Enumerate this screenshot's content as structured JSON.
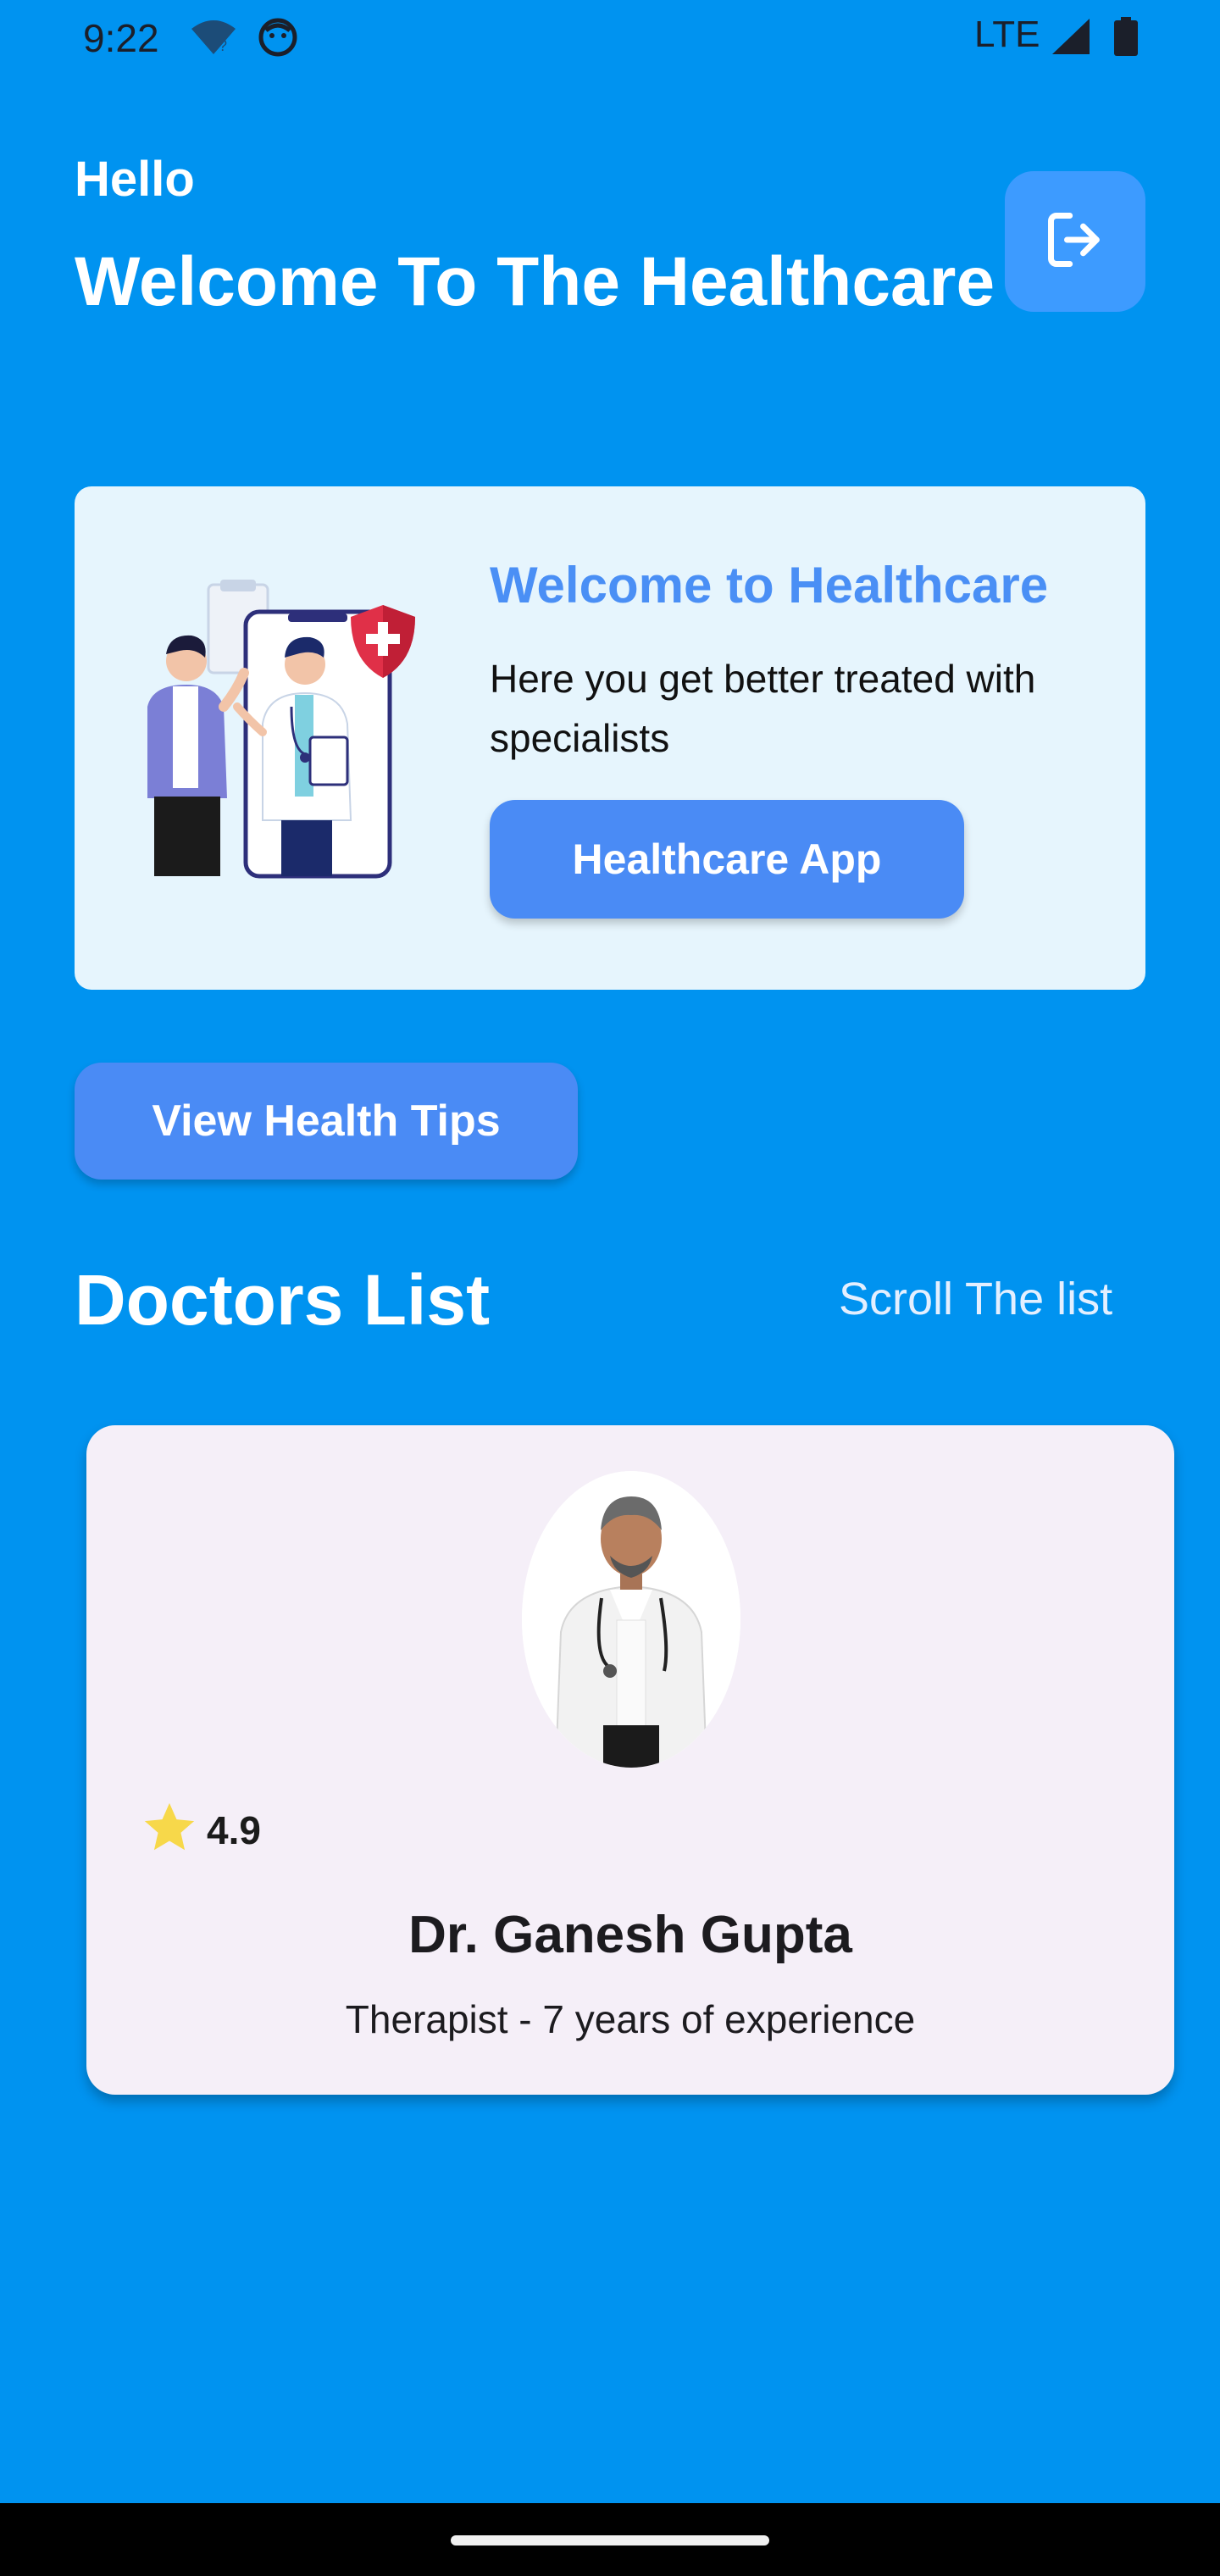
{
  "status_bar": {
    "time": "9:22",
    "network": "LTE",
    "icons": [
      "wifi-icon",
      "face-icon",
      "signal-icon",
      "battery-icon"
    ]
  },
  "header": {
    "greeting": "Hello",
    "title": "Welcome To The Healthcare",
    "logout_icon": "logout-icon"
  },
  "welcome_card": {
    "heading": "Welcome to Healthcare",
    "description": "Here you get better treated with specialists",
    "button_label": "Healthcare App"
  },
  "tips_button_label": "View Health Tips",
  "doctors_section": {
    "title": "Doctors List",
    "scroll_hint": "Scroll The list"
  },
  "doctor": {
    "rating": "4.9",
    "name": "Dr. Ganesh Gupta",
    "description": "Therapist - 7 years of experience"
  },
  "colors": {
    "background": "#0093f0",
    "accent": "#4a8bf5",
    "card_background": "#e6f5fd",
    "doctor_card_background": "#f5eff8",
    "star": "#f7d84a"
  }
}
